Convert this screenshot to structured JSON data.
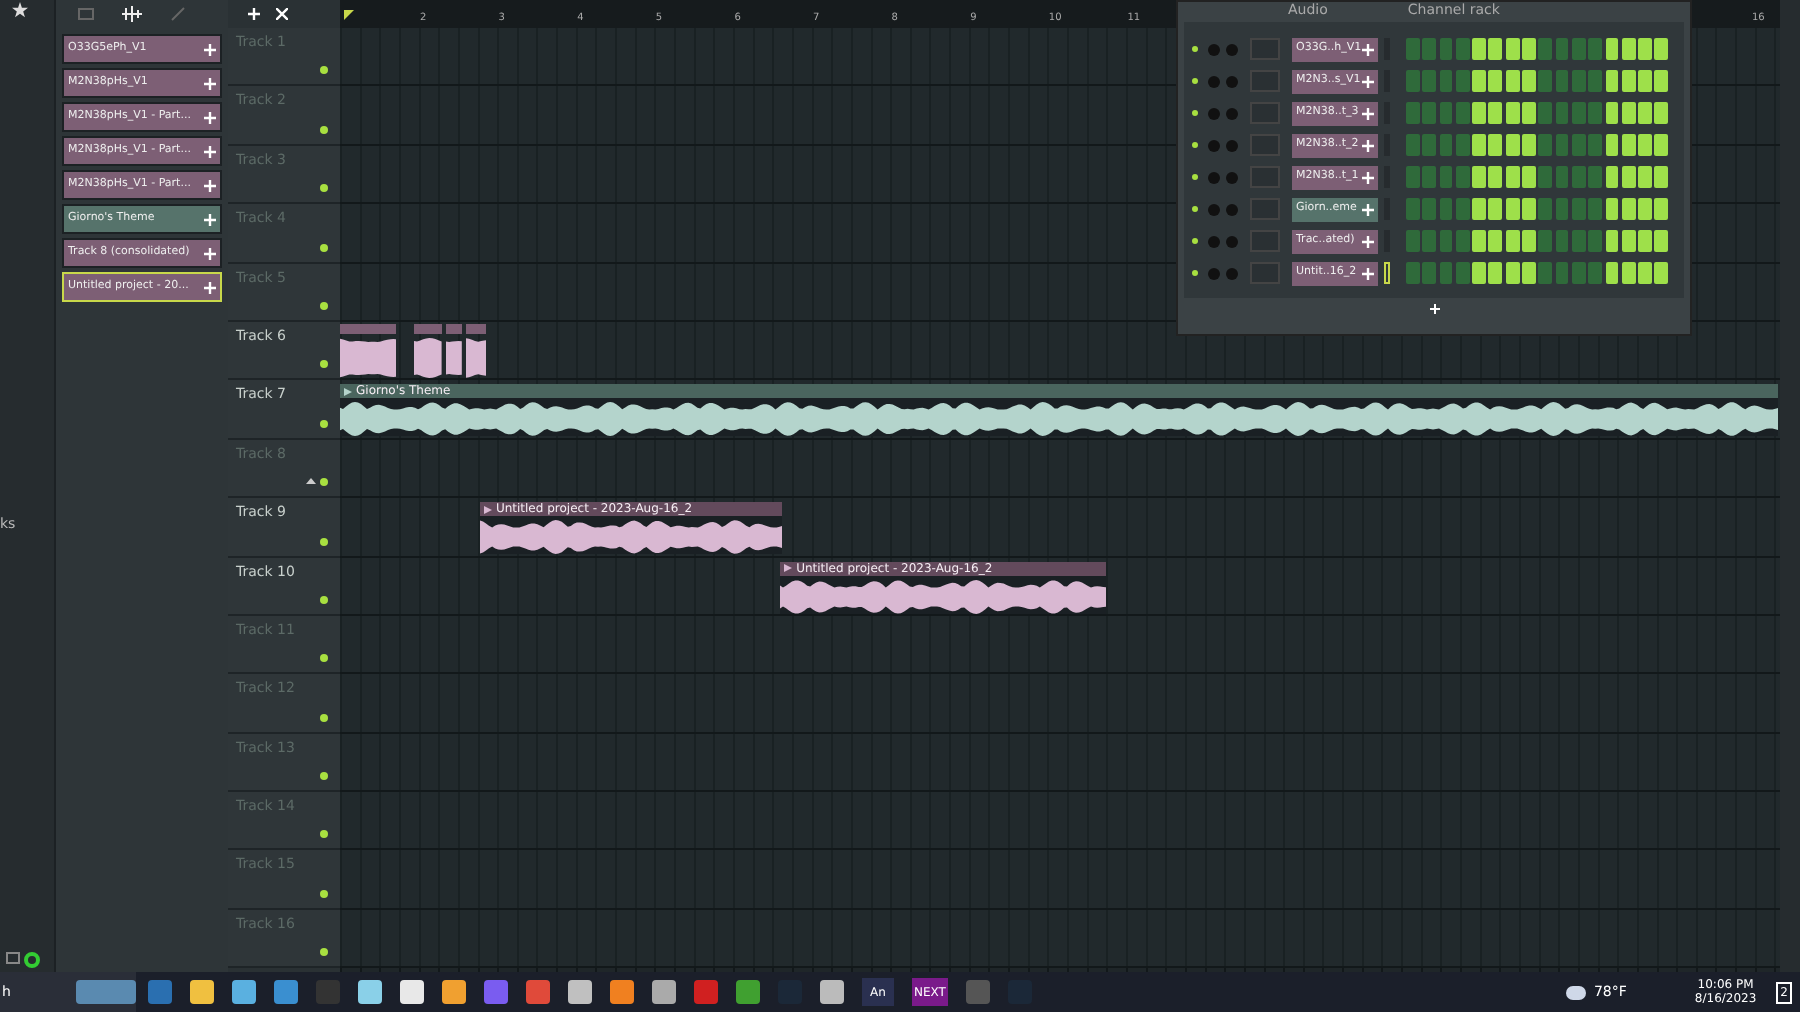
{
  "browser": {
    "partial_label": "ks"
  },
  "clip_list": [
    {
      "label": "O33G5ePh_V1",
      "color": "#7d5f75",
      "selected": false
    },
    {
      "label": "M2N38pHs_V1",
      "color": "#7d5f75",
      "selected": false
    },
    {
      "label": "M2N38pHs_V1 - Part...",
      "color": "#7d5f75",
      "selected": false
    },
    {
      "label": "M2N38pHs_V1 - Part...",
      "color": "#7d5f75",
      "selected": false
    },
    {
      "label": "M2N38pHs_V1 - Part...",
      "color": "#7d5f75",
      "selected": false
    },
    {
      "label": "Giorno's Theme",
      "color": "#56736b",
      "selected": false
    },
    {
      "label": "Track 8 (consolidated)",
      "color": "#7d5f75",
      "selected": false
    },
    {
      "label": "Untitled project - 20...",
      "color": "#7d5f75",
      "selected": true
    }
  ],
  "ruler": [
    "2",
    "3",
    "4",
    "5",
    "6",
    "7",
    "8",
    "9",
    "10",
    "11",
    "16"
  ],
  "tracks": [
    {
      "label": "Track 1",
      "dimmed": true
    },
    {
      "label": "Track 2",
      "dimmed": true
    },
    {
      "label": "Track 3",
      "dimmed": true
    },
    {
      "label": "Track 4",
      "dimmed": true
    },
    {
      "label": "Track 5",
      "dimmed": true
    },
    {
      "label": "Track 6",
      "dimmed": false,
      "clips": [
        {
          "kind": "short",
          "color": "#d9b8d2"
        },
        {
          "kind": "short",
          "color": "#d9b8d2"
        },
        {
          "kind": "short",
          "color": "#d9b8d2"
        },
        {
          "kind": "short",
          "color": "#d9b8d2"
        }
      ]
    },
    {
      "label": "Track 7",
      "dimmed": false,
      "clips": [
        {
          "kind": "long",
          "title": "Giorno's Theme",
          "color": "#b4d4cc"
        }
      ]
    },
    {
      "label": "Track 8",
      "dimmed": true
    },
    {
      "label": "Track 9",
      "dimmed": false,
      "clips": [
        {
          "kind": "long",
          "title": "Untitled project - 2023-Aug-16_2",
          "color": "#d9b8d2"
        }
      ]
    },
    {
      "label": "Track 10",
      "dimmed": false,
      "clips": [
        {
          "kind": "long",
          "title": "Untitled project - 2023-Aug-16_2",
          "color": "#d9b8d2"
        }
      ]
    },
    {
      "label": "Track 11",
      "dimmed": true
    },
    {
      "label": "Track 12",
      "dimmed": true
    },
    {
      "label": "Track 13",
      "dimmed": true
    },
    {
      "label": "Track 14",
      "dimmed": true
    },
    {
      "label": "Track 15",
      "dimmed": true
    },
    {
      "label": "Track 16",
      "dimmed": true
    }
  ],
  "channel_rack": {
    "title": "Channel rack",
    "filter": "Audio",
    "channels": [
      {
        "name": "O33G..h_V1",
        "color": "#7d5f75",
        "selected": false,
        "steps": [
          false,
          false,
          false,
          false,
          true,
          true,
          true,
          true,
          false,
          false,
          false,
          false,
          true,
          true,
          true,
          true
        ]
      },
      {
        "name": "M2N3..s_V1",
        "color": "#7d5f75",
        "selected": false,
        "steps": [
          false,
          false,
          false,
          false,
          true,
          true,
          true,
          true,
          false,
          false,
          false,
          false,
          true,
          true,
          true,
          true
        ]
      },
      {
        "name": "M2N38..t_3",
        "color": "#7d5f75",
        "selected": false,
        "steps": [
          false,
          false,
          false,
          false,
          true,
          true,
          true,
          true,
          false,
          false,
          false,
          false,
          true,
          true,
          true,
          true
        ]
      },
      {
        "name": "M2N38..t_2",
        "color": "#7d5f75",
        "selected": false,
        "steps": [
          false,
          false,
          false,
          false,
          true,
          true,
          true,
          true,
          false,
          false,
          false,
          false,
          true,
          true,
          true,
          true
        ]
      },
      {
        "name": "M2N38..t_1",
        "color": "#7d5f75",
        "selected": false,
        "steps": [
          false,
          false,
          false,
          false,
          true,
          true,
          true,
          true,
          false,
          false,
          false,
          false,
          true,
          true,
          true,
          true
        ]
      },
      {
        "name": "Giorn..eme",
        "color": "#56736b",
        "selected": false,
        "steps": [
          false,
          false,
          false,
          false,
          true,
          true,
          true,
          true,
          false,
          false,
          false,
          false,
          true,
          true,
          true,
          true
        ]
      },
      {
        "name": "Trac..ated)",
        "color": "#7d5f75",
        "selected": false,
        "steps": [
          false,
          false,
          false,
          false,
          true,
          true,
          true,
          true,
          false,
          false,
          false,
          false,
          true,
          true,
          true,
          true
        ]
      },
      {
        "name": "Untit..16_2",
        "color": "#7d5f75",
        "selected": true,
        "steps": [
          false,
          false,
          false,
          false,
          true,
          true,
          true,
          true,
          false,
          false,
          false,
          false,
          true,
          true,
          true,
          true
        ]
      }
    ]
  },
  "taskbar": {
    "search": "h",
    "apps": [
      {
        "kind": "icon"
      },
      {
        "kind": "icon"
      },
      {
        "kind": "icon"
      },
      {
        "kind": "icon"
      },
      {
        "kind": "icon"
      },
      {
        "kind": "icon"
      },
      {
        "kind": "icon"
      },
      {
        "kind": "icon"
      },
      {
        "kind": "icon"
      },
      {
        "kind": "icon"
      },
      {
        "kind": "icon"
      },
      {
        "kind": "icon"
      },
      {
        "kind": "icon"
      },
      {
        "kind": "icon"
      },
      {
        "kind": "icon"
      },
      {
        "kind": "icon"
      },
      {
        "kind": "icon"
      },
      {
        "kind": "text",
        "label": "An"
      },
      {
        "kind": "text",
        "label": "NEXT"
      },
      {
        "kind": "icon"
      },
      {
        "kind": "icon"
      }
    ],
    "weather": "78°F",
    "time": "10:06 PM",
    "date": "8/16/2023",
    "notifications": "2"
  }
}
